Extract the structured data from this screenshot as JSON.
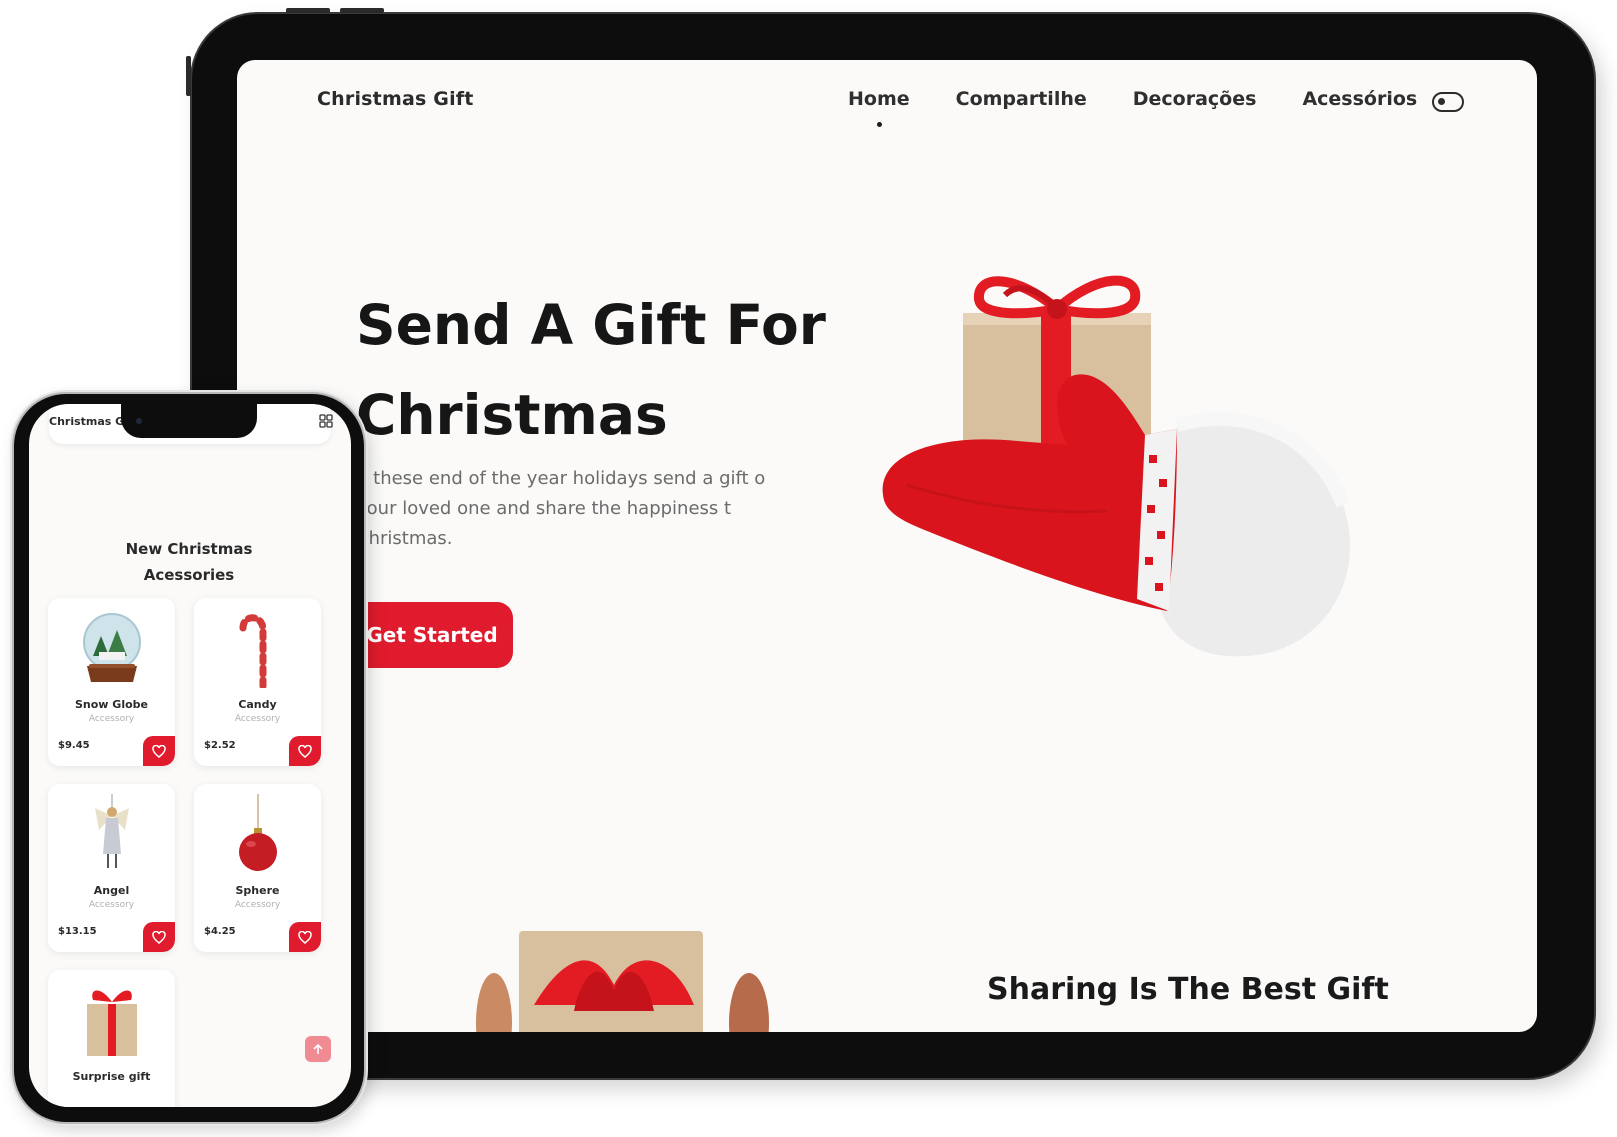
{
  "tablet": {
    "logo": "Christmas Gift",
    "nav": [
      {
        "label": "Home",
        "active": true
      },
      {
        "label": "Compartilhe",
        "active": false
      },
      {
        "label": "Decorações",
        "active": false
      },
      {
        "label": "Acessórios",
        "active": false
      }
    ],
    "theme_toggle_icon": "toggle-icon",
    "hero": {
      "title": "Send A Gift For Christmas",
      "description": "n these end of the year holidays send a gift o your loved one and share the happiness t Christmas.",
      "cta": "Get Started"
    },
    "next_section_title": "Sharing Is The Best Gift"
  },
  "phone": {
    "logo": "Christmas G",
    "menu_icon": "grid-icon",
    "section_title": "New Christmas Acessories",
    "products": [
      {
        "name": "Snow Globe",
        "category": "Accessory",
        "price": "$9.45",
        "icon": "snow-globe-icon"
      },
      {
        "name": "Candy",
        "category": "Accessory",
        "price": "$2.52",
        "icon": "candy-cane-icon"
      },
      {
        "name": "Angel",
        "category": "Accessory",
        "price": "$13.15",
        "icon": "angel-icon"
      },
      {
        "name": "Sphere",
        "category": "Accessory",
        "price": "$4.25",
        "icon": "ornament-icon"
      },
      {
        "name": "Surprise gift",
        "category": "",
        "price": "",
        "icon": "gift-box-icon"
      }
    ],
    "favorite_icon": "heart-icon",
    "scroll_top_icon": "arrow-up-icon"
  },
  "colors": {
    "accent": "#e01b2d",
    "background": "#fbfaf9",
    "text": "#161616",
    "muted": "#6b6b6b",
    "device": "#0d0d0d"
  }
}
